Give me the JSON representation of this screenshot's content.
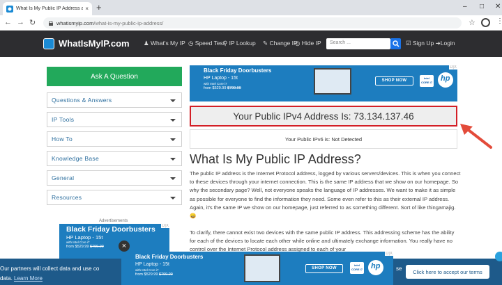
{
  "browser": {
    "tab_title": "What Is My Public IP Address an...",
    "tab_close": "×",
    "new_tab": "+",
    "url_host": "whatismyip.com",
    "url_path": "/what-is-my-public-ip-address/",
    "minimize": "–",
    "maximize": "□",
    "close": "✕"
  },
  "site": {
    "logo": "WhatIsMyIP.com",
    "menu": {
      "what_is_my_ip": "What's My IP",
      "speed_test": "Speed Test",
      "ip_lookup": "IP Lookup",
      "change_ip": "Change IP",
      "hide_ip": "Hide IP"
    },
    "search_placeholder": "Search ...",
    "signup": "Sign Up",
    "login": "Login"
  },
  "sidebar": {
    "ask_button": "Ask A Question",
    "items": [
      "Questions & Answers",
      "IP Tools",
      "How To",
      "Knowledge Base",
      "General",
      "Resources"
    ],
    "ad_label": "Advertisements"
  },
  "ad": {
    "headline": "Black Friday Doorbusters",
    "product": "HP Laptop - 15t",
    "cpu": "with Intel Core i7",
    "price_prefix": "from $529.99",
    "old_price": "$799.99",
    "shop_now": "SHOP NOW",
    "intel": "intel CORE i7",
    "hp": "hp",
    "ad_choices": "D|X"
  },
  "main": {
    "ipv4_label": "Your Public IPv4 Address Is: 73.134.137.46",
    "ipv6_label": "Your Public IPv6 is: Not Detected",
    "heading": "What Is My Public IP Address?",
    "para1": "The public IP address is the Internet Protocol address, logged by various servers/devices.  This is when you connect to these devices through your internet connection. This is the same IP address that we show on our homepage. So why the secondary page? Well, not everyone speaks the language of IP addresses.  We want to make it as simple as possible for everyone to find the information they need. Some even refer to this as their external IP address. Again, it's the same IP we show on our homepage, just referred to as something different. Sort of like thingamajig. 😀",
    "para2": "To clarify, there cannot exist two devices with the same public IP address. This addressing scheme has the ability for each of the devices to locate each other while online and ultimately exchange information.  You really have no control over the Internet Protocol address assigned to each of your"
  },
  "cookie": {
    "text": "Our partners will collect data and use co",
    "text2": "data.",
    "learn_more": "Learn More",
    "use_frag": "se",
    "accept": "Click here to accept our terms"
  },
  "colors": {
    "header": "#2d2d30",
    "accent_green": "#22a95b",
    "link_blue": "#2c6e9e",
    "ad_blue": "#1d7dbf",
    "highlight_red": "#d31f26",
    "cookie_bar": "#1e5a8a"
  }
}
